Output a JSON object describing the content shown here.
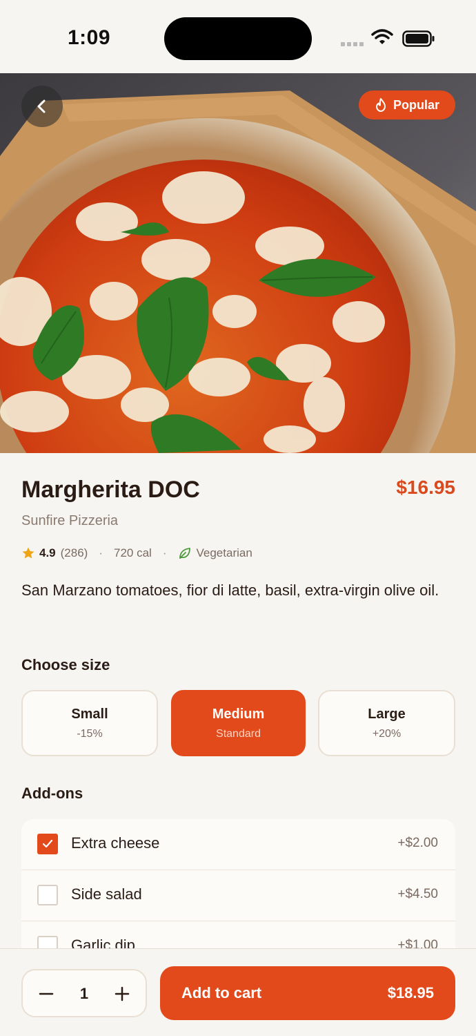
{
  "status_bar": {
    "time": "1:09"
  },
  "hero": {
    "badge_label": "Popular",
    "badge_icon": "flame-icon",
    "back_icon": "chevron-left-icon"
  },
  "item": {
    "name": "Margherita DOC",
    "price": "$16.95",
    "restaurant": "Sunfire Pizzeria",
    "rating": "4.9",
    "reviews": "(286)",
    "calories": "720 cal",
    "diet": "Vegetarian",
    "description": "San Marzano tomatoes, fior di latte, basil, extra-virgin olive oil."
  },
  "sizes": {
    "title": "Choose size",
    "options": [
      {
        "name": "Small",
        "detail": "-15%",
        "selected": false
      },
      {
        "name": "Medium",
        "detail": "Standard",
        "selected": true
      },
      {
        "name": "Large",
        "detail": "+20%",
        "selected": false
      }
    ]
  },
  "addons": {
    "title": "Add-ons",
    "items": [
      {
        "label": "Extra cheese",
        "price": "+$2.00",
        "checked": true
      },
      {
        "label": "Side salad",
        "price": "+$4.50",
        "checked": false
      },
      {
        "label": "Garlic dip",
        "price": "+$1.00",
        "checked": false
      }
    ]
  },
  "cart": {
    "quantity": "1",
    "button_label": "Add to cart",
    "total": "$18.95"
  },
  "colors": {
    "accent": "#e24a1c",
    "price": "#d94a1e",
    "background": "#f7f5f1"
  }
}
